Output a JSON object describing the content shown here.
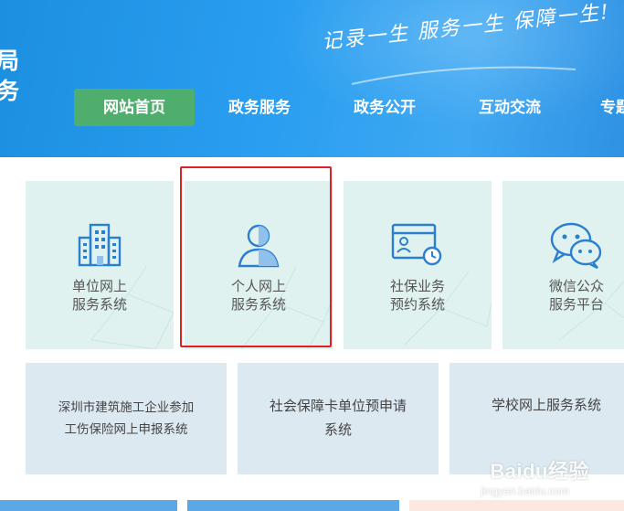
{
  "header": {
    "org_lines": [
      "局",
      "务"
    ],
    "slogan": "记录一生 服务一生 保障一生!"
  },
  "nav": [
    {
      "label": "网站首页",
      "active": true
    },
    {
      "label": "政务服务",
      "active": false
    },
    {
      "label": "政务公开",
      "active": false
    },
    {
      "label": "互动交流",
      "active": false
    },
    {
      "label": "专题",
      "active": false
    }
  ],
  "service_tiles": [
    {
      "line1": "单位网上",
      "line2": "服务系统",
      "icon": "building-icon"
    },
    {
      "line1": "个人网上",
      "line2": "服务系统",
      "icon": "person-icon"
    },
    {
      "line1": "社保业务",
      "line2": "预约系统",
      "icon": "appointment-calendar-icon"
    },
    {
      "line1": "微信公众",
      "line2": "服务平台",
      "icon": "wechat-icon"
    }
  ],
  "system_tiles": [
    {
      "line1": "深圳市建筑施工企业参加",
      "line2": "工伤保险网上申报系统"
    },
    {
      "line1": "社会保障卡单位预申请",
      "line2": "系统"
    },
    {
      "line1": "学校网上服务系统",
      "line2": ""
    }
  ],
  "watermark": {
    "brand": "Baidu经验",
    "sub": "jingyan.baidu.com"
  },
  "colors": {
    "header_blue": "#2a9ef0",
    "active_nav": "#4fae6e",
    "tile_mint": "#dff2ef",
    "tile_blue": "#dde9f1",
    "icon_blue": "#2b7fd0",
    "highlight_red": "#e02020"
  }
}
